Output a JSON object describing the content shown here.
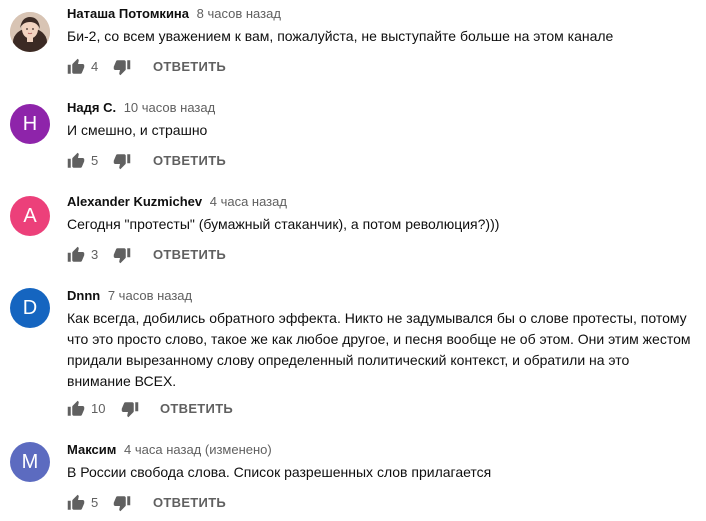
{
  "comments": [
    {
      "author": "Наташа Потомкина",
      "time": "8 часов назад",
      "text": "Би-2, со всем уважением к вам, пожалуйста, не выступайте больше на этом канале",
      "likes": "4",
      "reply_label": "ОТВЕТИТЬ",
      "avatar": {
        "type": "photo",
        "letter": "",
        "color": "#c9b7a8"
      }
    },
    {
      "author": "Надя С.",
      "time": "10 часов назад",
      "text": "И смешно, и страшно",
      "likes": "5",
      "reply_label": "ОТВЕТИТЬ",
      "avatar": {
        "type": "letter",
        "letter": "H",
        "color": "#8e24aa"
      }
    },
    {
      "author": "Alexander Kuzmichev",
      "time": "4 часа назад",
      "text": "Сегодня \"протесты\" (бумажный стаканчик), а потом революция?)))",
      "likes": "3",
      "reply_label": "ОТВЕТИТЬ",
      "avatar": {
        "type": "letter",
        "letter": "A",
        "color": "#ec407a"
      }
    },
    {
      "author": "Dnnn",
      "time": "7 часов назад",
      "text": "Как всегда, добились обратного эффекта. Никто не задумывался бы о слове протесты, потому что это просто слово, такое же как любое другое, и песня вообще не об этом. Они этим жестом придали вырезанному слову определенный политический контекст, и обратили на это внимание ВСЕХ.",
      "likes": "10",
      "reply_label": "ОТВЕТИТЬ",
      "avatar": {
        "type": "letter",
        "letter": "D",
        "color": "#1565c0"
      }
    },
    {
      "author": "Максим",
      "time": "4 часа назад (изменено)",
      "text": "В России свобода слова. Список разрешенных  слов прилагается",
      "likes": "5",
      "reply_label": "ОТВЕТИТЬ",
      "avatar": {
        "type": "letter",
        "letter": "M",
        "color": "#5c6bc0"
      }
    }
  ],
  "icons": {
    "like": "thumbs-up-icon",
    "dislike": "thumbs-down-icon"
  },
  "colors": {
    "author": "#0f0f0f",
    "secondary": "#606060",
    "icon": "#606060"
  }
}
